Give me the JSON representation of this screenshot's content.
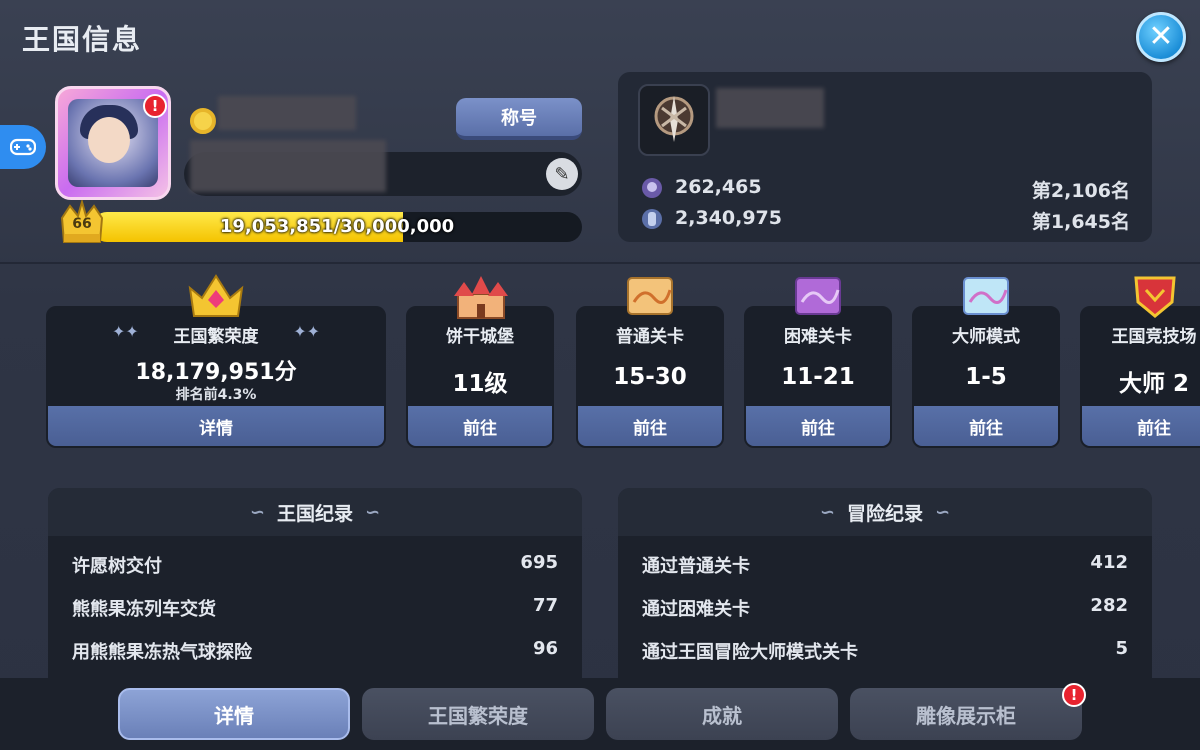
{
  "header": {
    "title": "王国信息"
  },
  "profile": {
    "title_button": "称号",
    "level": "66",
    "xp_text": "19,053,851/30,000,000",
    "xp_current": 19053851,
    "xp_max": 30000000
  },
  "guild": {
    "stats": [
      {
        "value": "262,465",
        "rank": "第2,106名"
      },
      {
        "value": "2,340,975",
        "rank": "第1,645名"
      }
    ]
  },
  "cards": {
    "prosperity": {
      "title": "王国繁荣度",
      "value": "18,179,951分",
      "sub": "排名前4.3%",
      "button": "详情"
    },
    "items": [
      {
        "title": "饼干城堡",
        "value": "11级",
        "button": "前往"
      },
      {
        "title": "普通关卡",
        "value": "15-30",
        "button": "前往"
      },
      {
        "title": "困难关卡",
        "value": "11-21",
        "button": "前往"
      },
      {
        "title": "大师模式",
        "value": "1-5",
        "button": "前往"
      },
      {
        "title": "王国竞技场",
        "value": "大师 2",
        "button": "前往"
      }
    ]
  },
  "kingdom_record": {
    "title": "王国纪录",
    "rows": [
      {
        "label": "许愿树交付",
        "value": "695"
      },
      {
        "label": "熊熊果冻列车交货",
        "value": "77"
      },
      {
        "label": "用熊熊果冻热气球探险",
        "value": "96"
      }
    ]
  },
  "adventure_record": {
    "title": "冒险纪录",
    "rows": [
      {
        "label": "通过普通关卡",
        "value": "412"
      },
      {
        "label": "通过困难关卡",
        "value": "282"
      },
      {
        "label": "通过王国冒险大师模式关卡",
        "value": "5"
      }
    ]
  },
  "tabs": [
    {
      "label": "详情",
      "active": true
    },
    {
      "label": "王国繁荣度",
      "active": false
    },
    {
      "label": "成就",
      "active": false
    },
    {
      "label": "雕像展示柜",
      "active": false
    }
  ],
  "colors": {
    "accent": "#2f8df0",
    "button": "#5870a8",
    "xp": "#f4c300",
    "alert": "#e8232f"
  }
}
